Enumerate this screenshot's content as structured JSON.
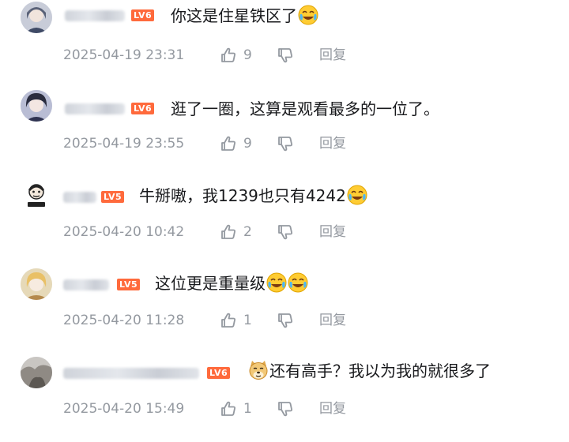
{
  "comments": [
    {
      "level": "LV6",
      "text": "你这是住星铁区了",
      "emojis": [
        "laugh-cry-emoji"
      ],
      "time": "2025-04-19 23:31",
      "likes": "9",
      "reply": "回复"
    },
    {
      "level": "LV6",
      "text": "逛了一圈，这算是观看最多的一位了。",
      "emojis": [],
      "time": "2025-04-19 23:55",
      "likes": "9",
      "reply": "回复"
    },
    {
      "level": "LV5",
      "text": "牛掰嗷，我1239也只有4242",
      "emojis": [
        "laugh-cry-emoji"
      ],
      "time": "2025-04-20 10:42",
      "likes": "2",
      "reply": "回复"
    },
    {
      "level": "LV5",
      "text": "这位更是重量级",
      "emojis": [
        "laugh-cry-emoji",
        "laugh-cry-emoji"
      ],
      "time": "2025-04-20 11:28",
      "likes": "1",
      "reply": "回复"
    },
    {
      "level": "LV6",
      "text": "还有高手？我以为我的就很多了",
      "emojis": [
        "doge-emoji"
      ],
      "time": "2025-04-20 15:49",
      "likes": "1",
      "reply": "回复"
    }
  ],
  "colors": {
    "level_badge": "#ff6a3c",
    "meta_text": "#9499a0",
    "body_text": "#18191c"
  }
}
